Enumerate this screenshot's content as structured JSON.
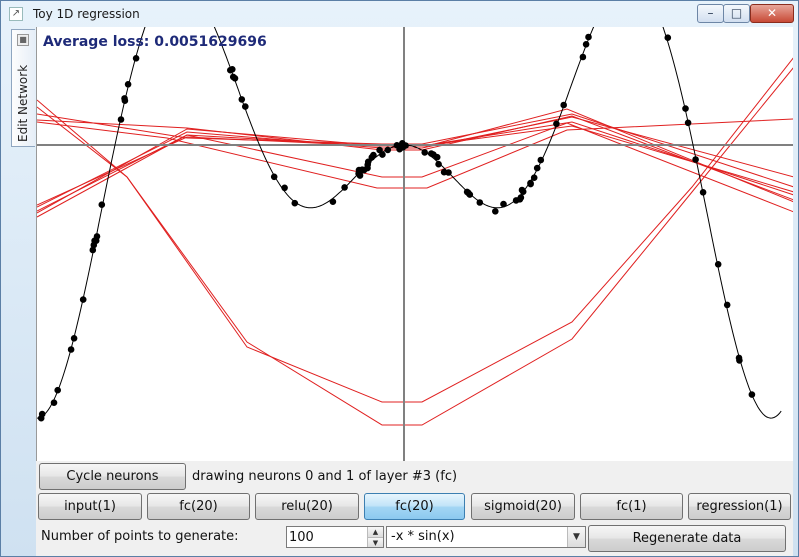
{
  "window": {
    "title": "Toy 1D regression",
    "minimize_glyph": "–",
    "maximize_glyph": "□",
    "close_glyph": "✕",
    "app_icon": "chart-icon"
  },
  "sidebar": {
    "tab_label": "Edit Network",
    "tab_icon": "pin-icon"
  },
  "plot": {
    "loss_text": "Average loss: 0.0051629696",
    "colors": {
      "axes": "#808080",
      "target_curve": "#000000",
      "neurons": "#e02020",
      "points": "#000000"
    }
  },
  "controls": {
    "cycle_label": "Cycle neurons",
    "status": "drawing neurons 0 and 1 of layer #3 (fc)",
    "layers": [
      {
        "label": "input(1)",
        "active": false
      },
      {
        "label": "fc(20)",
        "active": false
      },
      {
        "label": "relu(20)",
        "active": false
      },
      {
        "label": "fc(20)",
        "active": true
      },
      {
        "label": "sigmoid(20)",
        "active": false
      },
      {
        "label": "fc(1)",
        "active": false
      },
      {
        "label": "regression(1)",
        "active": false
      }
    ],
    "points_label": "Number of points to generate:",
    "points_value": "100",
    "function_value": "-x * sin(x)",
    "regenerate_label": "Regenerate data"
  }
}
